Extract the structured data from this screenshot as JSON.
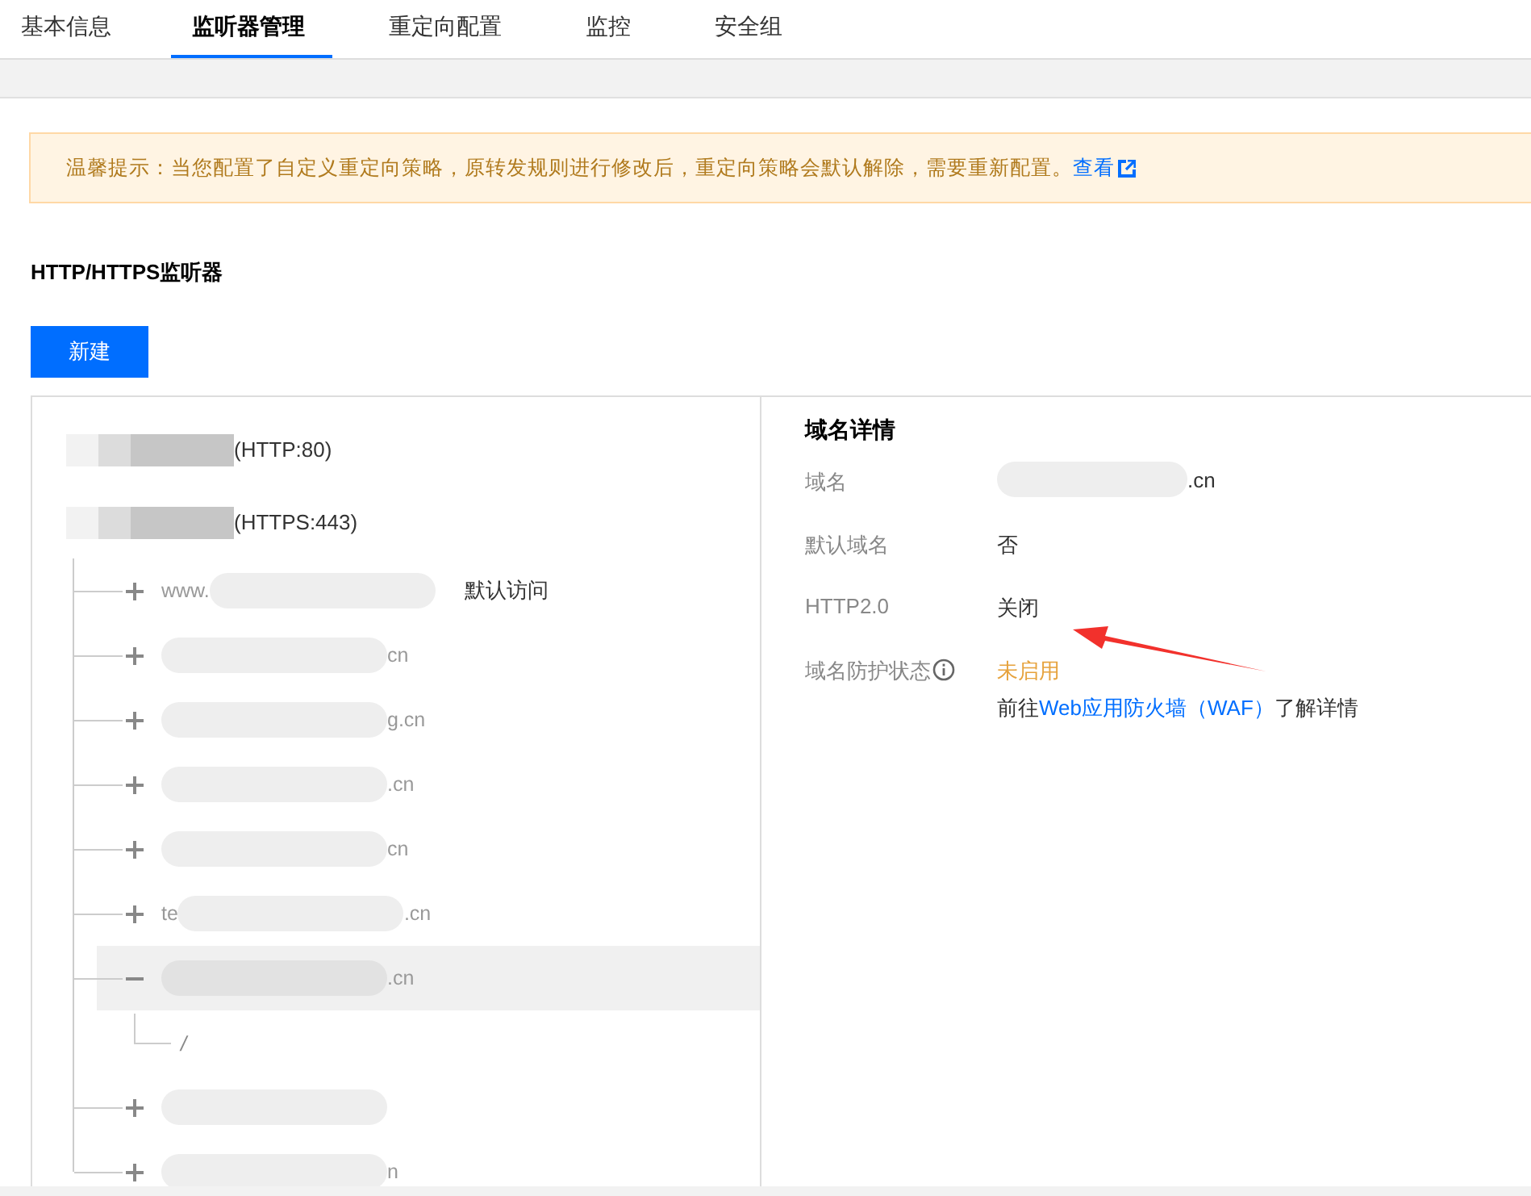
{
  "tabs": [
    {
      "label": "基本信息",
      "selected": false
    },
    {
      "label": "监听器管理",
      "selected": true
    },
    {
      "label": "重定向配置",
      "selected": false
    },
    {
      "label": "监控",
      "selected": false
    },
    {
      "label": "安全组",
      "selected": false
    }
  ],
  "notice": {
    "text": "温馨提示：当您配置了自定义重定向策略，原转发规则进行修改后，重定向策略会默认解除，需要重新配置。",
    "link": "查看"
  },
  "section_title": "HTTP/HTTPS监听器",
  "new_button": "新建",
  "listeners": [
    {
      "label": "(HTTP:80)"
    },
    {
      "label": "(HTTPS:443)",
      "domains": [
        {
          "prefix": "www.",
          "tag": "默认访问",
          "expanded": false,
          "selected": false
        },
        {
          "suffix": "cn",
          "expanded": false,
          "selected": false
        },
        {
          "suffix": "g.cn",
          "expanded": false,
          "selected": false
        },
        {
          "suffix": ".cn",
          "expanded": false,
          "selected": false
        },
        {
          "suffix": "cn",
          "expanded": false,
          "selected": false
        },
        {
          "prefix": "te",
          "suffix": ".cn",
          "expanded": false,
          "selected": false
        },
        {
          "suffix": ".cn",
          "expanded": true,
          "selected": true,
          "children": [
            {
              "label": "/"
            }
          ]
        },
        {
          "expanded": false,
          "selected": false
        },
        {
          "suffix": "n",
          "expanded": false,
          "selected": false
        }
      ]
    }
  ],
  "details": {
    "title": "域名详情",
    "rows": [
      {
        "kind": "domain",
        "label": "域名",
        "suffix": ".cn"
      },
      {
        "kind": "text",
        "label": "默认域名",
        "value": "否"
      },
      {
        "kind": "text",
        "label": "HTTP2.0",
        "value": "关闭"
      },
      {
        "kind": "protection",
        "label": "域名防护状态",
        "status": "未启用",
        "pre": "前往",
        "link": "Web应用防火墙（WAF）",
        "post": "了解详情"
      }
    ]
  }
}
